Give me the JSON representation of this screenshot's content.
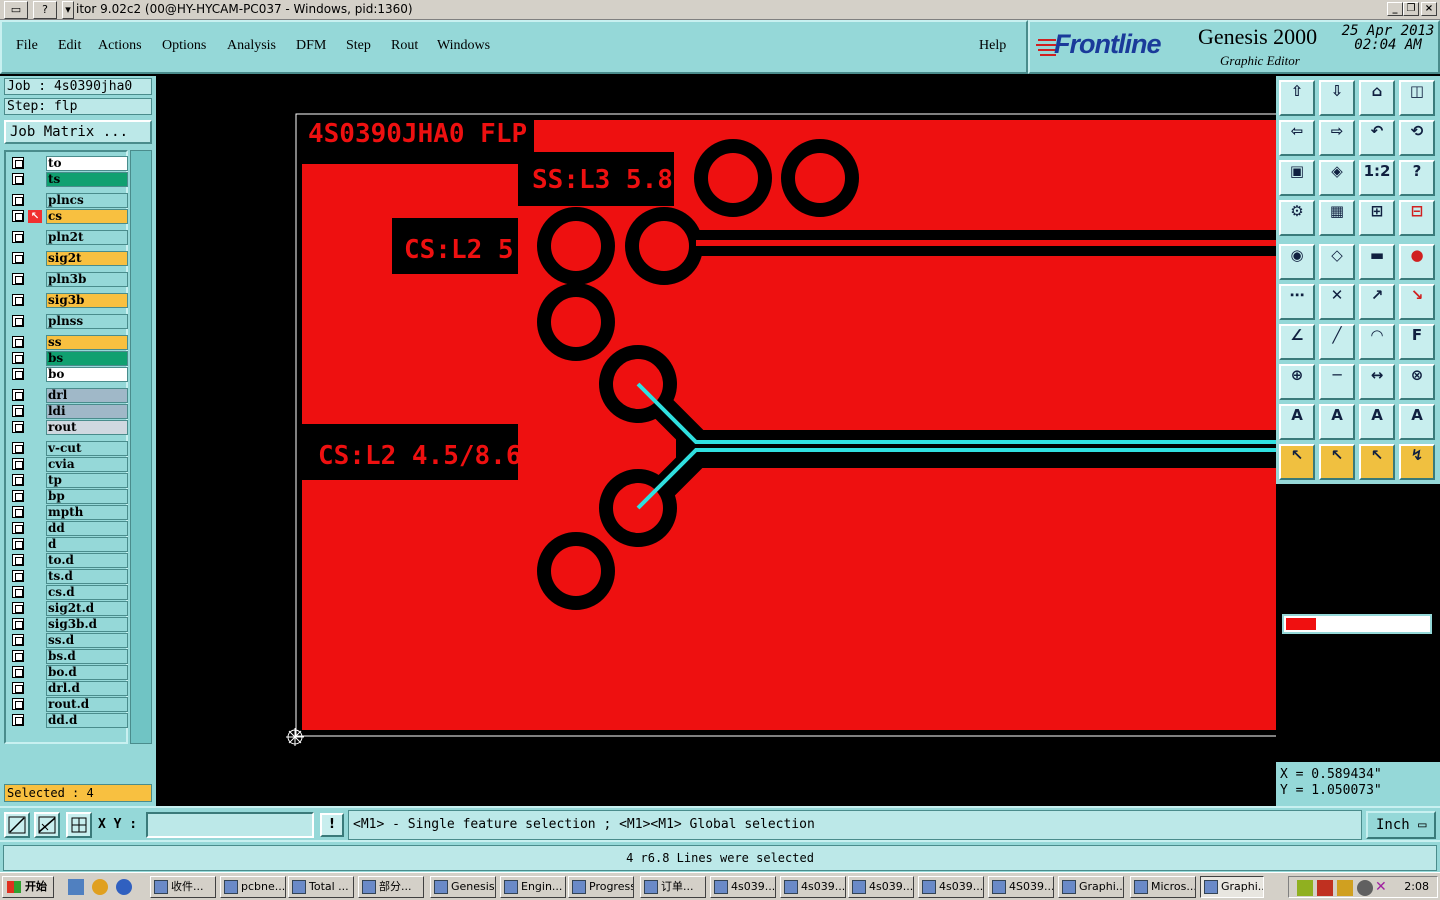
{
  "window": {
    "title": "itor 9.02c2 (00@HY-HYCAM-PC037 - Windows, pid:1360)",
    "help_glyph": "?"
  },
  "menu": {
    "items": [
      "File",
      "Edit",
      "Actions",
      "Options",
      "Analysis",
      "DFM",
      "Step",
      "Rout",
      "Windows"
    ],
    "help": "Help"
  },
  "brand": {
    "logo": "Frontline",
    "product": "Genesis 2000",
    "subtitle": "Graphic Editor",
    "date": "25 Apr 2013",
    "time": "02:04 AM"
  },
  "job": {
    "job_label": "Job : 4s0390jha0",
    "step_label": "Step: flp",
    "matrix_button": "Job Matrix ..."
  },
  "layers": [
    {
      "name": "to",
      "color": "#ffffff"
    },
    {
      "name": "ts",
      "color": "#10a070"
    },
    {
      "name": "plncs",
      "color": "#95d8d8"
    },
    {
      "name": "cs",
      "color": "#f8c040",
      "active": true
    },
    {
      "name": "pln2t",
      "color": "#95d8d8"
    },
    {
      "name": "sig2t",
      "color": "#f8c040"
    },
    {
      "name": "pln3b",
      "color": "#95d8d8"
    },
    {
      "name": "sig3b",
      "color": "#f8c040"
    },
    {
      "name": "plnss",
      "color": "#95d8d8"
    },
    {
      "name": "ss",
      "color": "#f8c040"
    },
    {
      "name": "bs",
      "color": "#10a070"
    },
    {
      "name": "bo",
      "color": "#ffffff"
    },
    {
      "name": "drl",
      "color": "#a0b8c8"
    },
    {
      "name": "ldi",
      "color": "#a0b8c8"
    },
    {
      "name": "rout",
      "color": "#d0d8e0"
    },
    {
      "name": "v-cut",
      "color": "#95d8d8"
    },
    {
      "name": "cvia",
      "color": "#95d8d8"
    },
    {
      "name": "tp",
      "color": "#95d8d8"
    },
    {
      "name": "bp",
      "color": "#95d8d8"
    },
    {
      "name": "mpth",
      "color": "#95d8d8"
    },
    {
      "name": "dd",
      "color": "#95d8d8"
    },
    {
      "name": "d",
      "color": "#95d8d8"
    },
    {
      "name": "to.d",
      "color": "#95d8d8"
    },
    {
      "name": "ts.d",
      "color": "#95d8d8"
    },
    {
      "name": "cs.d",
      "color": "#95d8d8"
    },
    {
      "name": "sig2t.d",
      "color": "#95d8d8"
    },
    {
      "name": "sig3b.d",
      "color": "#95d8d8"
    },
    {
      "name": "ss.d",
      "color": "#95d8d8"
    },
    {
      "name": "bs.d",
      "color": "#95d8d8"
    },
    {
      "name": "bo.d",
      "color": "#95d8d8"
    },
    {
      "name": "drl.d",
      "color": "#95d8d8"
    },
    {
      "name": "rout.d",
      "color": "#95d8d8"
    },
    {
      "name": "dd.d",
      "color": "#95d8d8"
    }
  ],
  "selected": "Selected : 4",
  "canvas": {
    "labels": {
      "job_title": "4S0390JHA0 FLP",
      "ss_label": "SS:L3 5.8",
      "cs_label_1": "CS:L2 5",
      "cs_label_2": "CS:L2 4.5/8.6"
    },
    "colors": {
      "copper": "#ee1010",
      "selected": "#30e0e0",
      "background": "#000000"
    }
  },
  "coords": {
    "x": "X = 0.589434\"",
    "y": "Y = 1.050073\""
  },
  "command": {
    "xy_label": "X Y :",
    "xy_value": "",
    "warn_glyph": "!",
    "prompt": "<M1> - Single feature selection ; <M1><M1> Global selection",
    "unit": "Inch"
  },
  "status": "4 r6.8 Lines were selected",
  "taskbar": {
    "start": "开始",
    "tasks": [
      "收件...",
      "pcbne...",
      "Total ...",
      "部分...",
      "Genesis",
      "Engin...",
      "Progress",
      "订单...",
      "4s039...",
      "4s039...",
      "4s039...",
      "4s039...",
      "4S039...",
      "Graphi...",
      "Micros...",
      "Graphi..."
    ],
    "clock": "2:08"
  }
}
